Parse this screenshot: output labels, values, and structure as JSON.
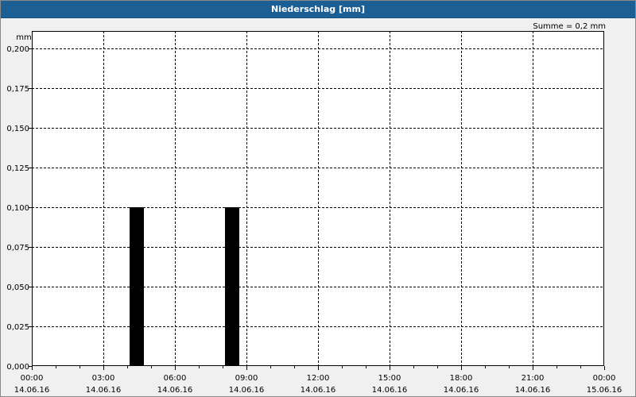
{
  "header": {
    "title": "Niederschlag [mm]"
  },
  "summary": {
    "text": "Summe = 0,2 mm"
  },
  "colors": {
    "titlebar": "#1c5f95",
    "plot_background": "#ffffff",
    "bar": "#000000",
    "grid": "#000000"
  },
  "chart_data": {
    "type": "bar",
    "title": "Niederschlag [mm]",
    "ylabel": "mm",
    "xlabel": "",
    "ylim": [
      0,
      0.2
    ],
    "yticks": [
      0,
      0.025,
      0.05,
      0.075,
      0.1,
      0.125,
      0.15,
      0.175,
      0.2
    ],
    "ytick_labels": [
      "0,000",
      "0,025",
      "0,050",
      "0,075",
      "0,100",
      "0,125",
      "0,150",
      "0,175",
      "0,200"
    ],
    "xlim_hours": [
      0,
      24
    ],
    "xticks_hours": [
      0,
      3,
      6,
      9,
      12,
      15,
      18,
      21,
      24
    ],
    "xtick_labels": [
      [
        "00:00",
        "14.06.16"
      ],
      [
        "03:00",
        "14.06.16"
      ],
      [
        "06:00",
        "14.06.16"
      ],
      [
        "09:00",
        "14.06.16"
      ],
      [
        "12:00",
        "14.06.16"
      ],
      [
        "15:00",
        "14.06.16"
      ],
      [
        "18:00",
        "14.06.16"
      ],
      [
        "21:00",
        "14.06.16"
      ],
      [
        "00:00",
        "15.06.16"
      ]
    ],
    "bars": [
      {
        "time": "14.06.16 04:00",
        "start_hour": 4,
        "end_hour": 5,
        "value": 0.1
      },
      {
        "time": "14.06.16 08:00",
        "start_hour": 8,
        "end_hour": 9,
        "value": 0.1
      }
    ],
    "grid": true,
    "grid_style": "dashed"
  }
}
